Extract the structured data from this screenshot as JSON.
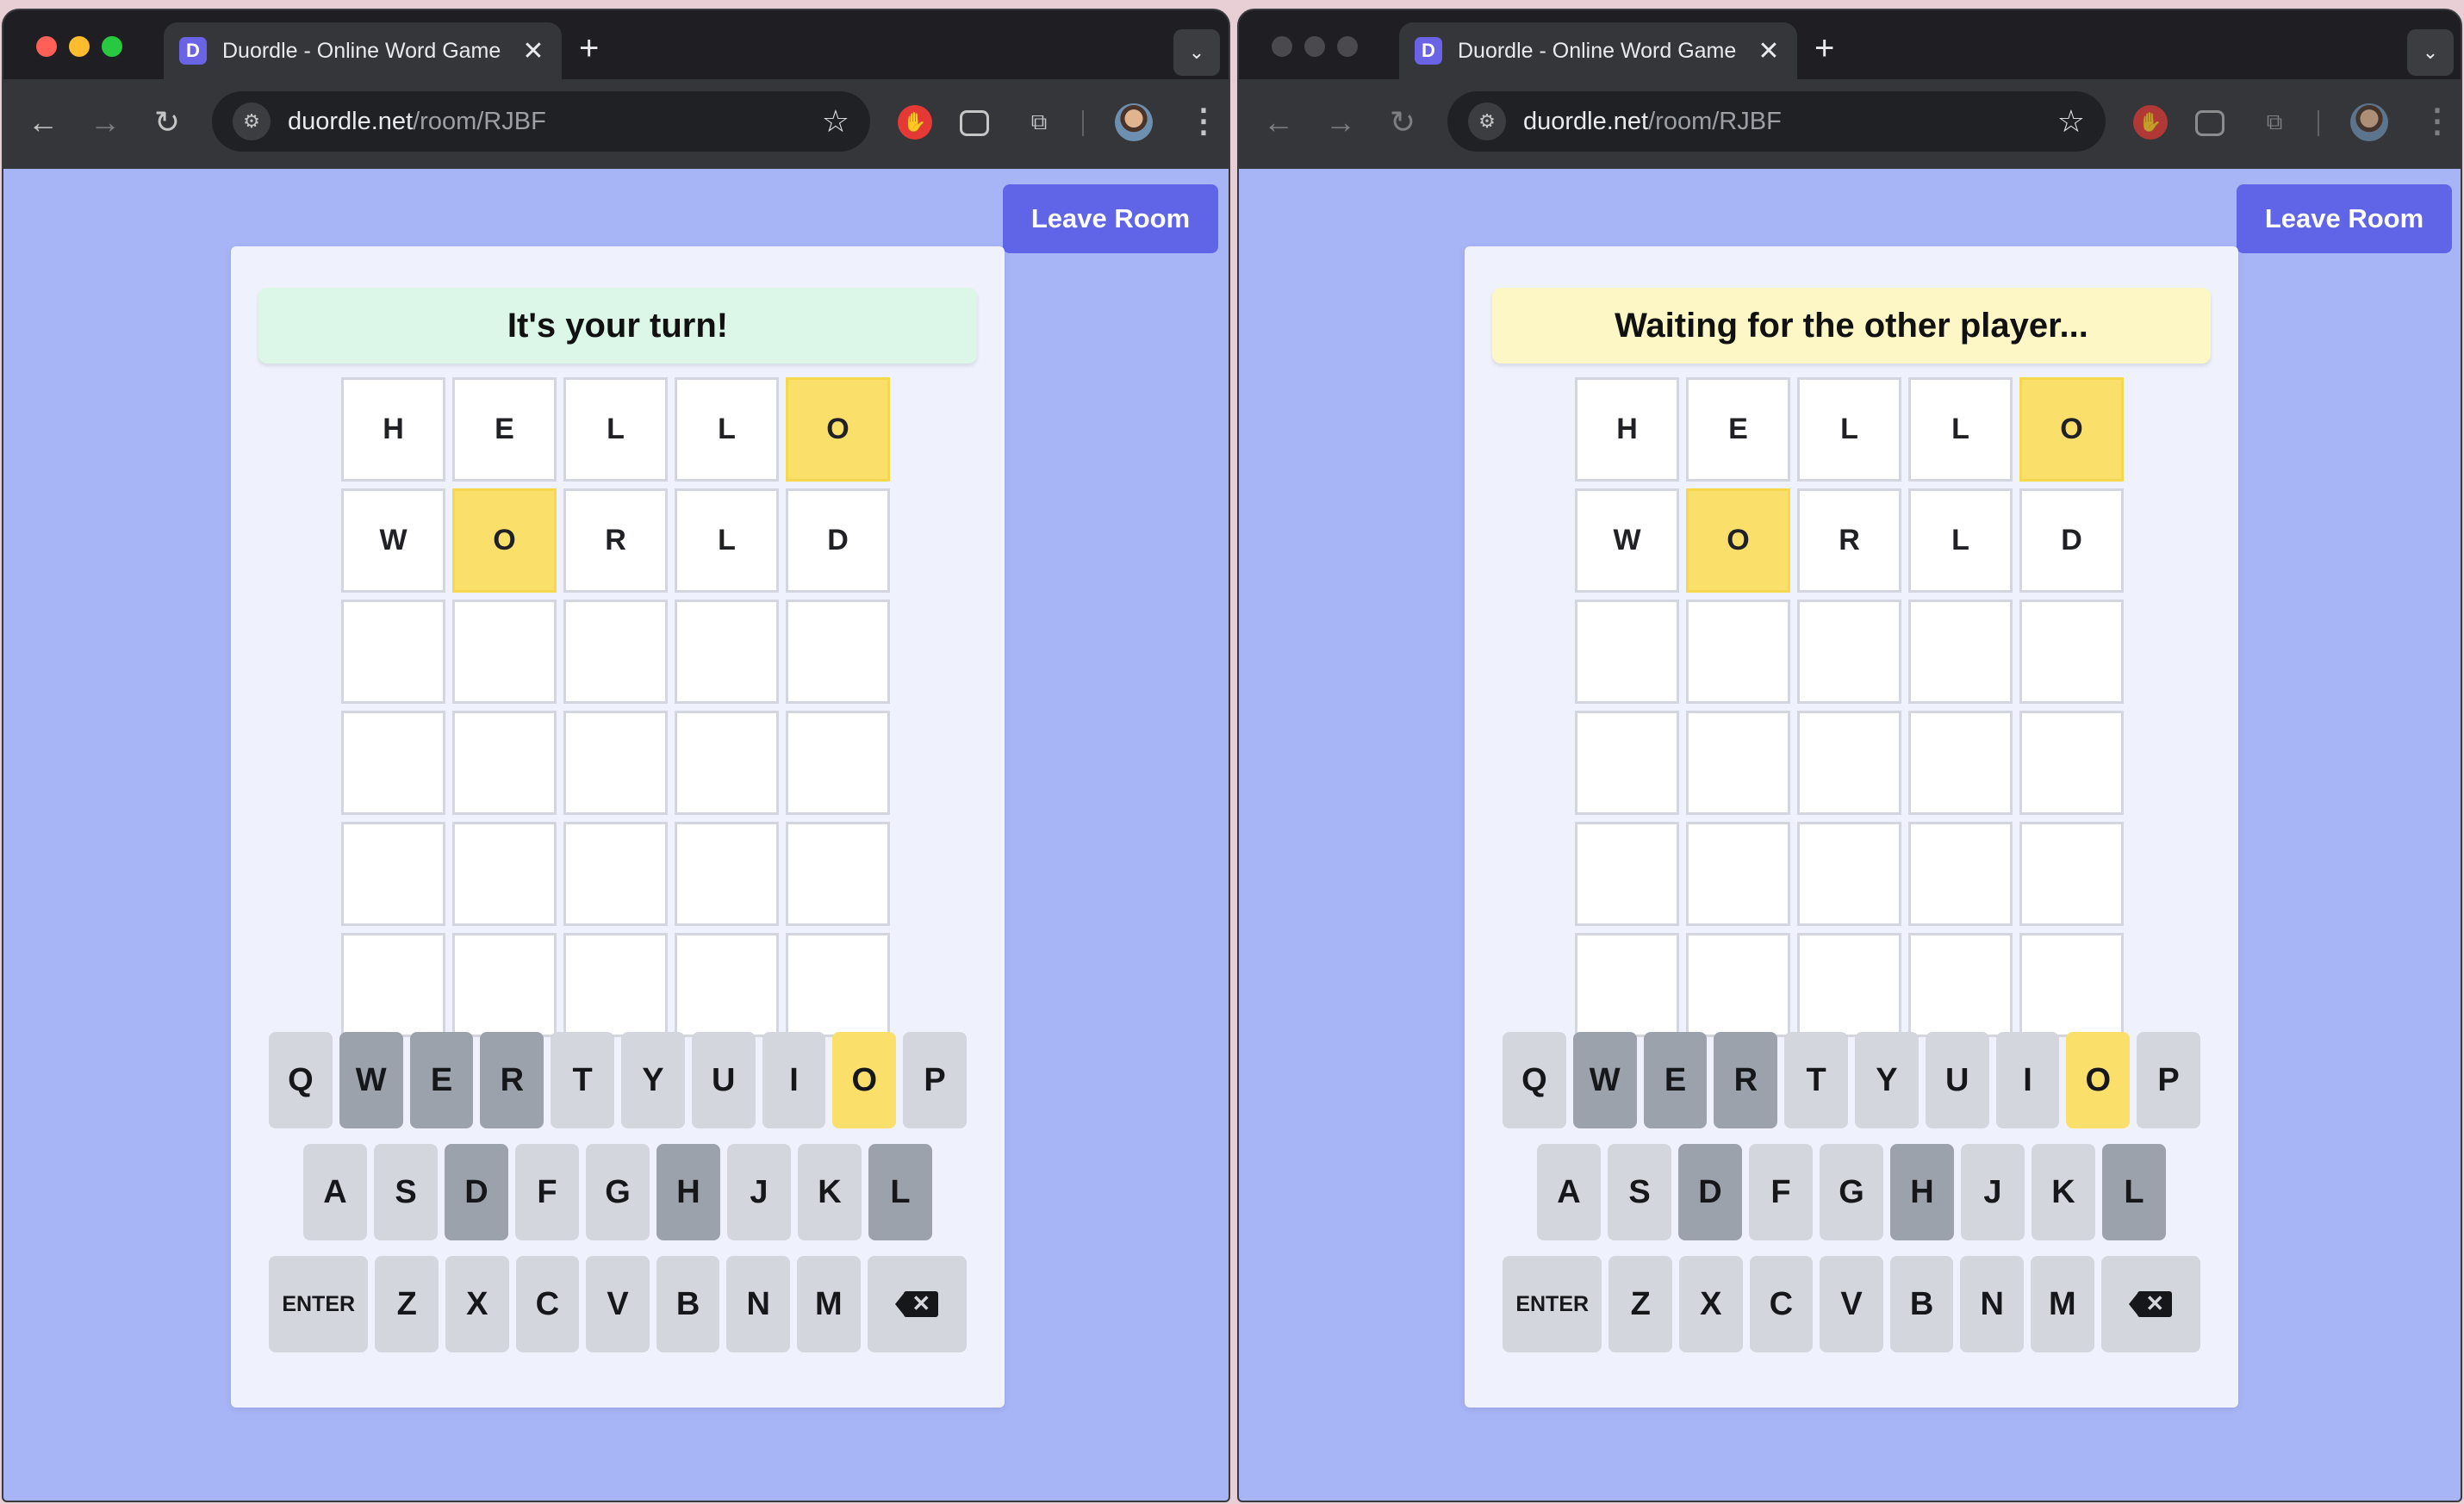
{
  "windows": [
    {
      "tab_title": "Duordle - Online Word Game",
      "favicon_letter": "D",
      "url_host": "duordle.net",
      "url_path": "/room/RJBF",
      "leave_label": "Leave Room",
      "status": "It's your turn!",
      "status_color": "#dcf7e8"
    },
    {
      "tab_title": "Duordle - Online Word Game",
      "favicon_letter": "D",
      "url_host": "duordle.net",
      "url_path": "/room/RJBF",
      "leave_label": "Leave Room",
      "status": "Waiting for the other player...",
      "status_color": "#fdf7c6"
    }
  ],
  "board": {
    "rows": [
      [
        {
          "l": "H",
          "s": ""
        },
        {
          "l": "E",
          "s": ""
        },
        {
          "l": "L",
          "s": ""
        },
        {
          "l": "L",
          "s": ""
        },
        {
          "l": "O",
          "s": "present"
        }
      ],
      [
        {
          "l": "W",
          "s": ""
        },
        {
          "l": "O",
          "s": "present"
        },
        {
          "l": "R",
          "s": ""
        },
        {
          "l": "L",
          "s": ""
        },
        {
          "l": "D",
          "s": ""
        }
      ],
      [
        {
          "l": "",
          "s": ""
        },
        {
          "l": "",
          "s": ""
        },
        {
          "l": "",
          "s": ""
        },
        {
          "l": "",
          "s": ""
        },
        {
          "l": "",
          "s": ""
        }
      ],
      [
        {
          "l": "",
          "s": ""
        },
        {
          "l": "",
          "s": ""
        },
        {
          "l": "",
          "s": ""
        },
        {
          "l": "",
          "s": ""
        },
        {
          "l": "",
          "s": ""
        }
      ],
      [
        {
          "l": "",
          "s": ""
        },
        {
          "l": "",
          "s": ""
        },
        {
          "l": "",
          "s": ""
        },
        {
          "l": "",
          "s": ""
        },
        {
          "l": "",
          "s": ""
        }
      ],
      [
        {
          "l": "",
          "s": ""
        },
        {
          "l": "",
          "s": ""
        },
        {
          "l": "",
          "s": ""
        },
        {
          "l": "",
          "s": ""
        },
        {
          "l": "",
          "s": ""
        }
      ]
    ]
  },
  "keyboard": {
    "rows": [
      [
        {
          "k": "Q",
          "s": ""
        },
        {
          "k": "W",
          "s": "absent"
        },
        {
          "k": "E",
          "s": "absent"
        },
        {
          "k": "R",
          "s": "absent"
        },
        {
          "k": "T",
          "s": ""
        },
        {
          "k": "Y",
          "s": ""
        },
        {
          "k": "U",
          "s": ""
        },
        {
          "k": "I",
          "s": ""
        },
        {
          "k": "O",
          "s": "present"
        },
        {
          "k": "P",
          "s": ""
        }
      ],
      [
        {
          "k": "A",
          "s": ""
        },
        {
          "k": "S",
          "s": ""
        },
        {
          "k": "D",
          "s": "absent"
        },
        {
          "k": "F",
          "s": ""
        },
        {
          "k": "G",
          "s": ""
        },
        {
          "k": "H",
          "s": "absent"
        },
        {
          "k": "J",
          "s": ""
        },
        {
          "k": "K",
          "s": ""
        },
        {
          "k": "L",
          "s": "absent"
        }
      ],
      [
        {
          "k": "ENTER",
          "s": "wide"
        },
        {
          "k": "Z",
          "s": ""
        },
        {
          "k": "X",
          "s": ""
        },
        {
          "k": "C",
          "s": ""
        },
        {
          "k": "V",
          "s": ""
        },
        {
          "k": "B",
          "s": ""
        },
        {
          "k": "N",
          "s": ""
        },
        {
          "k": "M",
          "s": ""
        },
        {
          "k": "",
          "s": "back"
        }
      ]
    ]
  },
  "colors": {
    "page_bg": "#a7b4f5",
    "button": "#6065e8",
    "present": "#fae06b",
    "absent": "#9ca2ac"
  },
  "icons": [
    "back-arrow-icon",
    "forward-arrow-icon",
    "reload-icon",
    "site-settings-icon",
    "star-icon",
    "extension-icon",
    "profile-avatar",
    "menu-icon",
    "backspace-icon"
  ]
}
